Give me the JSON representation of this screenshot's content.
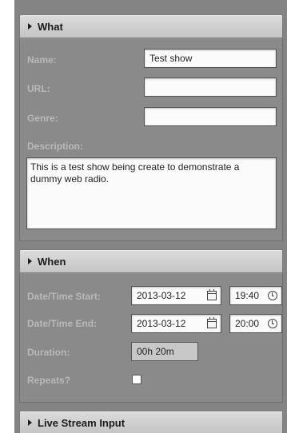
{
  "sections": {
    "what": {
      "title": "What",
      "fields": {
        "name": {
          "label": "Name:",
          "value": "Test show"
        },
        "url": {
          "label": "URL:",
          "value": ""
        },
        "genre": {
          "label": "Genre:",
          "value": ""
        },
        "description": {
          "label": "Description:",
          "value": "This is a test show being create to demonstrate a dummy web radio."
        }
      }
    },
    "when": {
      "title": "When",
      "fields": {
        "start": {
          "label": "Date/Time Start:",
          "date": "2013-03-12",
          "time": "19:40"
        },
        "end": {
          "label": "Date/Time End:",
          "date": "2013-03-12",
          "time": "20:00"
        },
        "duration": {
          "label": "Duration:",
          "value": "00h 20m"
        },
        "repeats": {
          "label": "Repeats?",
          "checked": false
        }
      }
    },
    "live_stream": {
      "title": "Live Stream Input"
    }
  },
  "icons": {
    "expand": "triangle-right-icon",
    "date_picker": "calendar-icon",
    "time_picker": "clock-icon"
  }
}
